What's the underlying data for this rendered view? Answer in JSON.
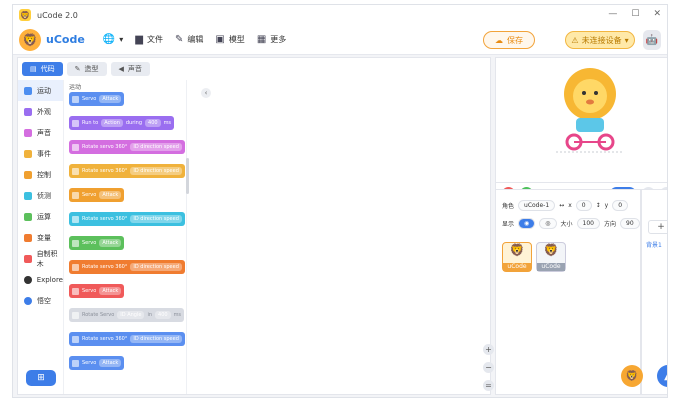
{
  "window": {
    "title": "uCode 2.0"
  },
  "brand": {
    "name": "uCode"
  },
  "menu": {
    "language_icon": "globe-icon",
    "items": [
      {
        "label": "文件",
        "icon": "folder-icon"
      },
      {
        "label": "编辑",
        "icon": "edit-icon"
      },
      {
        "label": "模型",
        "icon": "model-icon"
      },
      {
        "label": "更多",
        "icon": "grid-icon"
      }
    ]
  },
  "toolbar": {
    "save_label": "保存",
    "device_label": "未连接设备"
  },
  "tabs": [
    {
      "label": "代码"
    },
    {
      "label": "造型"
    },
    {
      "label": "声音"
    }
  ],
  "categories": [
    {
      "label": "运动",
      "color": "#4d8ef0"
    },
    {
      "label": "外观",
      "color": "#9a6ef0"
    },
    {
      "label": "声音",
      "color": "#d46ee0"
    },
    {
      "label": "事件",
      "color": "#f0b23c"
    },
    {
      "label": "控制",
      "color": "#f0a030"
    },
    {
      "label": "侦测",
      "color": "#3cc0e0"
    },
    {
      "label": "运算",
      "color": "#5cc05c"
    },
    {
      "label": "变量",
      "color": "#f07c30"
    },
    {
      "label": "自制积木",
      "color": "#f05a5a"
    },
    {
      "label": "Explore",
      "color": "#333333"
    },
    {
      "label": "悟空",
      "color": "#3d7de8"
    }
  ],
  "palette": {
    "section_title": "运动",
    "blocks": [
      {
        "text": "Servo",
        "chip": "Attack",
        "color": "#5b8ff0"
      },
      {
        "text": "Run to",
        "chip": "Action",
        "extra": "during",
        "chip2": "400",
        "unit": "ms",
        "color": "#9a6ef0"
      },
      {
        "text": "Rotate servo 360°",
        "chip": "ID direction speed",
        "color": "#d46ee0"
      },
      {
        "text": "Rotate servo 360°",
        "chip": "ID direction speed",
        "color": "#f0b23c"
      },
      {
        "text": "Servo",
        "chip": "Attack",
        "color": "#f0a030"
      },
      {
        "text": "Rotate servo 360°",
        "chip": "ID direction speed",
        "color": "#3cc0e0"
      },
      {
        "text": "Servo",
        "chip": "Attack",
        "color": "#5cc05c"
      },
      {
        "text": "Rotate servo 360°",
        "chip": "ID direction speed",
        "color": "#f07c30"
      },
      {
        "text": "Servo",
        "chip": "Attack",
        "color": "#f05a5a"
      },
      {
        "text": "Rotate Servo",
        "chip": "ID Angle",
        "extra": "in",
        "chip2": "400",
        "unit": "ms",
        "color": "#d8dbe2"
      },
      {
        "text": "Rotate servo 360°",
        "chip": "ID direction speed",
        "color": "#5b8ff0"
      },
      {
        "text": "Servo",
        "chip": "Attack",
        "color": "#5b8ff0"
      }
    ]
  },
  "sprite": {
    "role_label": "角色",
    "name": "uCode-1",
    "x_label": "x",
    "x": "0",
    "y_label": "y",
    "y": "0",
    "show_label": "显示",
    "size_label": "大小",
    "size": "100",
    "direction_label": "方向",
    "direction": "90",
    "cards": [
      {
        "label": "uCode"
      },
      {
        "label": "uCode"
      }
    ]
  },
  "background": {
    "label": "背景1"
  },
  "zoom": {
    "in": "+",
    "out": "−",
    "reset": "="
  }
}
